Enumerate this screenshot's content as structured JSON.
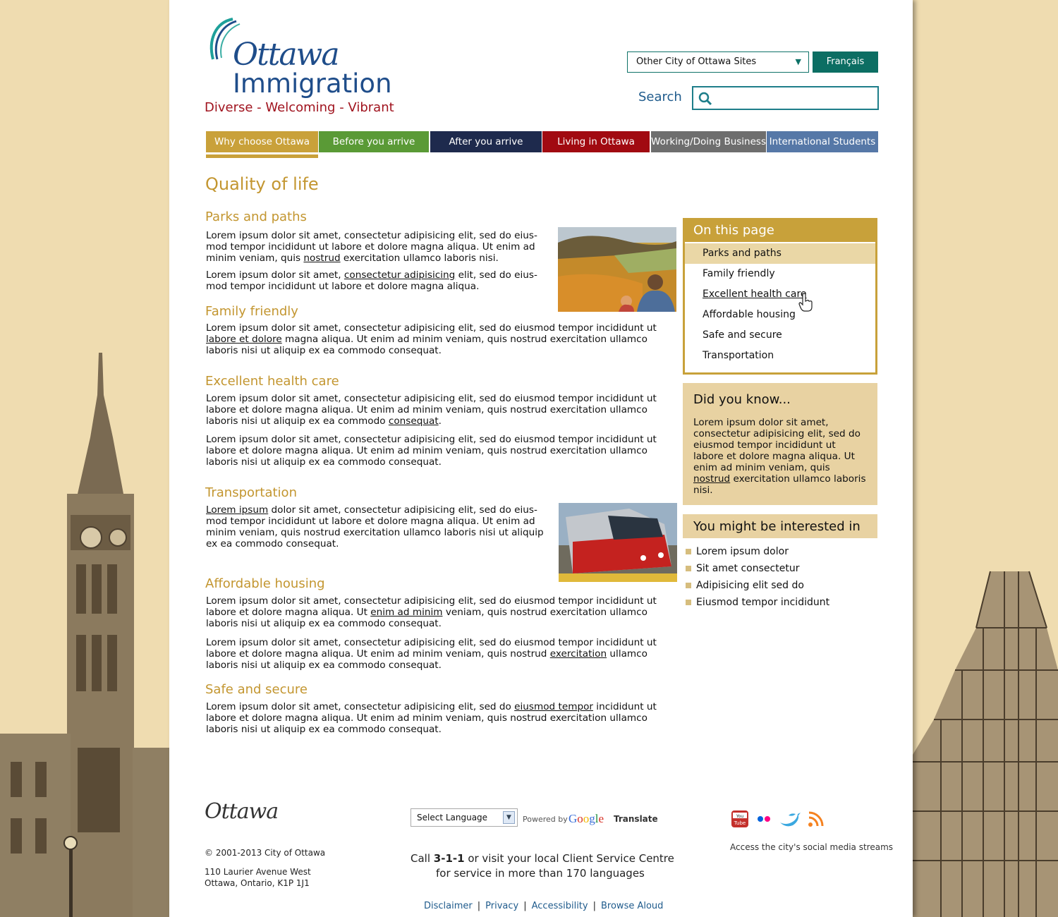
{
  "header": {
    "logo_word": "Ottawa",
    "logo_sub": "Immigration",
    "tagline": "Diverse - Welcoming - Vibrant",
    "other_sites_label": "Other City of Ottawa Sites",
    "language_button": "Français",
    "search_label": "Search",
    "search_placeholder": ""
  },
  "nav": {
    "tabs": [
      {
        "label": "Why choose Ottawa",
        "color": "#c9a13a"
      },
      {
        "label": "Before you arrive",
        "color": "#5a9a36"
      },
      {
        "label": "After you arrive",
        "color": "#1e2a4d"
      },
      {
        "label": "Living in Ottawa",
        "color": "#a10a11"
      },
      {
        "label": "Working/Doing Business",
        "color": "#6e6e6e"
      },
      {
        "label": "International Students",
        "color": "#5678a7"
      }
    ]
  },
  "main": {
    "page_title": "Quality of life",
    "parks": {
      "heading": "Parks and paths",
      "p1_a": "Lorem ipsum dolor sit amet, consectetur adipisicing elit, sed do eius-",
      "p1_b": "mod tempor incididunt ut labore et dolore magna aliqua. Ut enim ad",
      "p1_c1": "minim veniam, quis ",
      "p1_c_link": "nostrud",
      "p1_c2": " exercitation ullamco laboris nisi.",
      "p2_a1": "Lorem ipsum dolor sit amet, ",
      "p2_a_link": "consectetur adipisicing",
      "p2_a2": " elit, sed do eius-",
      "p2_b": "mod tempor incididunt ut labore et dolore magna aliqua."
    },
    "family": {
      "heading": "Family friendly",
      "l1": "Lorem ipsum dolor sit amet, consectetur adipisicing elit, sed do eiusmod tempor incididunt ut",
      "l2_link": "labore et dolore",
      "l2_rest": " magna aliqua. Ut enim ad minim veniam, quis nostrud exercitation ullamco",
      "l3": "laboris nisi ut aliquip ex ea commodo consequat."
    },
    "health": {
      "heading": "Excellent health care",
      "p1_l1": "Lorem ipsum dolor sit amet, consectetur adipisicing elit, sed do eiusmod tempor incididunt ut",
      "p1_l2": "labore et dolore magna aliqua. Ut enim ad minim veniam, quis nostrud exercitation ullamco",
      "p1_l3a": "laboris nisi ut aliquip ex ea commodo ",
      "p1_l3_link": "consequat",
      "p1_l3b": ".",
      "p2_l1": "Lorem ipsum dolor sit amet, consectetur adipisicing elit, sed do eiusmod tempor incididunt ut",
      "p2_l2": "labore et dolore magna aliqua. Ut enim ad minim veniam, quis nostrud exercitation ullamco",
      "p2_l3": "laboris nisi ut aliquip ex ea commodo consequat."
    },
    "transport": {
      "heading": "Transportation",
      "l1_link": "Lorem ipsum",
      "l1_rest": " dolor sit amet, consectetur adipisicing elit, sed do eius-",
      "l2": "mod tempor incididunt ut labore et dolore magna aliqua. Ut enim ad",
      "l3": "minim veniam, quis nostrud exercitation ullamco laboris nisi ut aliquip",
      "l4": "ex ea commodo consequat."
    },
    "housing": {
      "heading": "Affordable housing",
      "p1_l1": "Lorem ipsum dolor sit amet, consectetur adipisicing elit, sed do eiusmod tempor incididunt ut",
      "p1_l2a": "labore et dolore magna aliqua. Ut ",
      "p1_l2_link": "enim ad minim",
      "p1_l2b": " veniam, quis nostrud exercitation ullamco",
      "p1_l3": "laboris nisi ut aliquip ex ea commodo consequat.",
      "p2_l1": "Lorem ipsum dolor sit amet, consectetur adipisicing elit, sed do eiusmod tempor incididunt ut",
      "p2_l2a": "labore et dolore magna aliqua. Ut enim ad minim veniam, quis nostrud ",
      "p2_l2_link": "exercitation",
      "p2_l2b": " ullamco",
      "p2_l3": "laboris nisi ut aliquip ex ea commodo consequat."
    },
    "safe": {
      "heading": "Safe and secure",
      "l1a": "Lorem ipsum dolor sit amet, consectetur adipisicing elit, sed do ",
      "l1_link": "eiusmod tempor",
      "l1b": " incididunt ut",
      "l2": "labore et dolore magna aliqua. Ut enim ad minim veniam, quis nostrud exercitation ullamco",
      "l3": "laboris nisi ut aliquip ex ea commodo consequat."
    }
  },
  "sidebar": {
    "on_this_page": {
      "title": "On this page",
      "items": [
        "Parks and paths",
        "Family friendly",
        "Excellent health care",
        "Affordable housing",
        "Safe and secure",
        "Transportation"
      ]
    },
    "did_you_know": {
      "title": "Did you know...",
      "text_a": "Lorem ipsum dolor sit amet, consectetur adipisicing elit, sed do eiusmod tempor incididunt ut labore et dolore magna aliqua. Ut enim ad minim veniam, quis ",
      "text_link": "nostrud",
      "text_b": " exercitation ullamco laboris nisi."
    },
    "interested": {
      "title": "You might be interested in",
      "items": [
        "Lorem ipsum dolor",
        "Sit amet consectetur",
        "Adipisicing elit sed do",
        "Eiusmod tempor incididunt"
      ]
    }
  },
  "footer": {
    "logo_word": "Ottawa",
    "copyright": "© 2001-2013 City of Ottawa",
    "address1": "110 Laurier Avenue West",
    "address2": "Ottawa, Ontario, K1P 1J1",
    "select_language": "Select Language",
    "powered_by": "Powered by",
    "google": "Google",
    "translate": "Translate",
    "call_a": "Call ",
    "call_number": "3-1-1",
    "call_b": " or visit your local Client Service Centre",
    "call_line2": "for service in more than 170 languages",
    "links": [
      "Disclaimer",
      "Privacy",
      "Accessibility",
      "Browse Aloud"
    ],
    "social_text": "Access the city's social media streams",
    "social_icons": [
      "youtube-icon",
      "flickr-icon",
      "twitter-icon",
      "rss-icon"
    ]
  }
}
